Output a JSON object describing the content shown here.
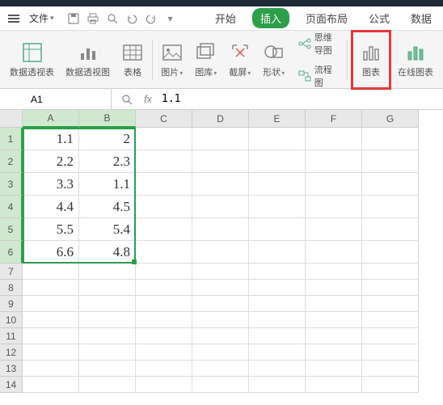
{
  "menubar": {
    "file_label": "文件",
    "tabs": [
      "开始",
      "插入",
      "页面布局",
      "公式",
      "数据"
    ],
    "active_index": 1
  },
  "ribbon": {
    "groups": [
      {
        "label": "数据透视表",
        "icon": "pivot-table"
      },
      {
        "label": "数据透视图",
        "icon": "pivot-chart"
      },
      {
        "label": "表格",
        "icon": "table"
      },
      {
        "label": "图片",
        "icon": "picture",
        "dropdown": true
      },
      {
        "label": "图库",
        "icon": "gallery",
        "dropdown": true
      },
      {
        "label": "截屏",
        "icon": "screenshot",
        "dropdown": true
      },
      {
        "label": "形状",
        "icon": "shapes",
        "dropdown": true
      }
    ],
    "small_items": [
      {
        "label": "思维导图",
        "icon": "mindmap"
      },
      {
        "label": "流程图",
        "icon": "flowchart"
      }
    ],
    "chart_label": "图表",
    "online_chart_label": "在线图表"
  },
  "namebox": {
    "value": "A1"
  },
  "formula": {
    "value": "1.1"
  },
  "columns": [
    "A",
    "B",
    "C",
    "D",
    "E",
    "F",
    "G"
  ],
  "selected_cols": [
    "A",
    "B"
  ],
  "selected_rows": [
    1,
    2,
    3,
    4,
    5,
    6
  ],
  "cells": {
    "A1": "1.1",
    "B1": "2",
    "A2": "2.2",
    "B2": "2.3",
    "A3": "3.3",
    "B3": "1.1",
    "A4": "4.4",
    "B4": "4.5",
    "A5": "5.5",
    "B5": "5.4",
    "A6": "6.6",
    "B6": "4.8"
  },
  "chart_data": {
    "type": "table",
    "categories": [
      "A",
      "B"
    ],
    "series": [
      {
        "name": "row1",
        "values": [
          1.1,
          2
        ]
      },
      {
        "name": "row2",
        "values": [
          2.2,
          2.3
        ]
      },
      {
        "name": "row3",
        "values": [
          3.3,
          1.1
        ]
      },
      {
        "name": "row4",
        "values": [
          4.4,
          4.5
        ]
      },
      {
        "name": "row5",
        "values": [
          5.5,
          5.4
        ]
      },
      {
        "name": "row6",
        "values": [
          6.6,
          4.8
        ]
      }
    ]
  }
}
